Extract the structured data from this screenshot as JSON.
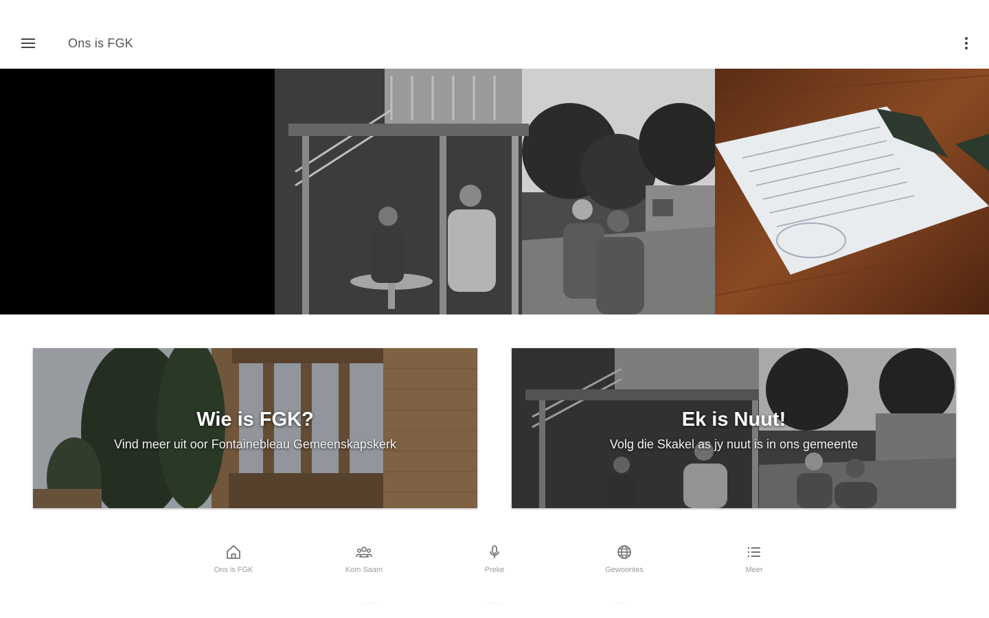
{
  "appbar": {
    "title": "Ons is FGK",
    "menu_icon": "hamburger-menu-icon",
    "overflow_icon": "more-vert-icon"
  },
  "carousel": {
    "slides": [
      {
        "description": "black panel"
      },
      {
        "description": "group of people outside stairs"
      },
      {
        "description": "church programme on wooden table"
      }
    ],
    "active_index": 1,
    "slide_count": 3
  },
  "cards": [
    {
      "title": "Wie is FGK?",
      "subtitle": "Vind meer uit oor Fontainebleau Gemeenskapskerk"
    },
    {
      "title": "Ek is Nuut!",
      "subtitle": "Volg die Skakel as jy nuut is in ons gemeente"
    }
  ],
  "bottom_nav": {
    "items": [
      {
        "label": "Ons is FGK",
        "icon": "home-icon"
      },
      {
        "label": "Kom Saam",
        "icon": "group-icon"
      },
      {
        "label": "Preke",
        "icon": "microphone-icon"
      },
      {
        "label": "Gewoontes",
        "icon": "globe-icon"
      },
      {
        "label": "Meer",
        "icon": "list-icon"
      }
    ]
  },
  "colors": {
    "appbar_bg": "#ffffff",
    "title_text": "#555555",
    "nav_label": "#9a9a9a",
    "card_title": "#ffffff"
  }
}
